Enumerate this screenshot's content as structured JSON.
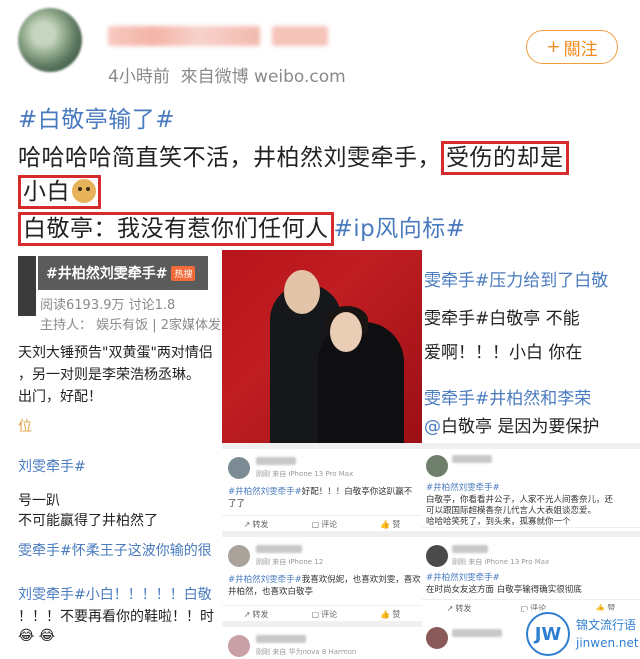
{
  "header": {
    "time_text": "4小時前",
    "source_text": "來自微博 weibo.com",
    "follow_label": "關注",
    "follow_icon": "plus-icon"
  },
  "post": {
    "hashtag_title": "#白敬亭输了#",
    "line1_a": "哈哈哈哈简直笑不活，井柏然刘雯牵手，",
    "line1_b": "受伤的却是",
    "line2_a": "小白",
    "line3_a": "白敬亭：我没有惹你们任何人",
    "line3_tag": "#ip风向标#"
  },
  "left_panel": {
    "hash_title": "#井柏然刘雯牵手#",
    "hot_badge": "热搜",
    "stats": "阅读6193.9万  讨论1.8",
    "host": "主持人：  娱乐有饭 | 2家媒体发",
    "l1": "天刘大锤预告\"双黄蛋\"两对情侣",
    "l2": "，另一对则是李荣浩杨丞琳。",
    "l3": "出门，好配！",
    "l4": "位",
    "l5": "刘雯牵手#",
    "l6": "号一趴",
    "l7": "不可能赢得了井柏然了",
    "l8": "雯牵手#怀柔王子这波你输的很",
    "l9": "刘雯牵手#小白！！！！！白敬",
    "l10": "！！！不要再看你的鞋啦！！时"
  },
  "mid_panel": {
    "c1_meta": "刚刚  来自 iPhone 13 Pro Max",
    "c1_text_tag": "#井柏然刘雯牵手#",
    "c1_text": "好配！！！白敬亭你这趴赢不",
    "c1_text2": "了了",
    "c2_meta": "刚刚  来自 iPhone 12",
    "c2_text_tag": "#井柏然刘雯牵手#",
    "c2_text": "我喜欢倪妮，也喜欢刘雯，喜欢",
    "c2_text2": "井柏然，也喜欢白敬亭",
    "c3_meta": "刚刚  来自 华为nova 8 Harmon",
    "share": "转发",
    "comment": "评论",
    "like": "赞"
  },
  "right_panel": {
    "r1": "雯牵手#压力给到了白敬",
    "r2": "雯牵手#白敬亭 不能",
    "r3": "爱啊！！！小白 你在",
    "r4": "雯牵手#井柏然和李荣",
    "r5": "白敬亭 是因为要保护",
    "c1_tag": "#井柏然刘雯牵手#",
    "c1_t1": "白敬亭，你看看井公子，人家不光人间香奈儿，还",
    "c1_t2": "可以跟国际超模香奈儿代言人大表姐谈恋爱。",
    "c1_t3": "哈哈哈笑死了，到头来，孤寡就你一个",
    "c2_meta": "刚刚  来自 iPhone 13 Pro Max",
    "c2_tag": "#井柏然刘雯牵手#",
    "c2_text": "在时尚女友这方面 白敬亭输得确实很彻底"
  },
  "watermark": {
    "logo": "JW",
    "t1": "锦文流行语",
    "t2": "jinwen.net"
  }
}
